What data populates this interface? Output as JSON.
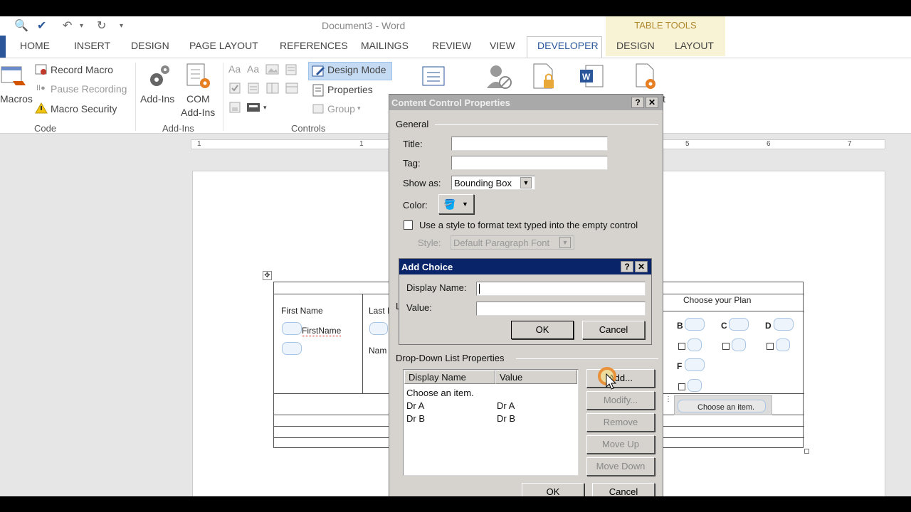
{
  "app": {
    "window_title": "Document3 - Word",
    "table_tools_label": "TABLE TOOLS"
  },
  "tabs": [
    "HOME",
    "INSERT",
    "DESIGN",
    "PAGE LAYOUT",
    "REFERENCES",
    "MAILINGS",
    "REVIEW",
    "VIEW",
    "DEVELOPER",
    "DESIGN",
    "LAYOUT"
  ],
  "ribbon": {
    "code": {
      "macros": "Macros",
      "record_macro": "Record Macro",
      "pause_recording": "Pause Recording",
      "macro_security": "Macro Security",
      "group_label": "Code"
    },
    "addins": {
      "add_ins": "Add-Ins",
      "com_line1": "COM",
      "com_line2": "Add-Ins",
      "group_label": "Add-Ins"
    },
    "controls": {
      "design_mode": "Design Mode",
      "properties": "Properties",
      "group": "Group",
      "group_label": "Controls"
    },
    "partial_t": "t"
  },
  "ruler": [
    "1",
    "1",
    "5",
    "6",
    "7"
  ],
  "document": {
    "first_name_label": "First Name",
    "first_name_field": "FirstName",
    "last_label": "Last I",
    "name_label": "Nam",
    "plan_header": "Choose your Plan",
    "plan_letters": [
      "B",
      "C",
      "D",
      "F"
    ],
    "choose_item": "Choose an item.",
    "pilcrow_l": "L"
  },
  "content_control_dialog": {
    "title": "Content Control Properties",
    "help_btn": "?",
    "close_btn": "✕",
    "general_label": "General",
    "title_label": "Title:",
    "tag_label": "Tag:",
    "show_as_label": "Show as:",
    "show_as_value": "Bounding Box",
    "color_label": "Color:",
    "use_style_label": "Use a style to format text typed into the empty control",
    "style_label": "Style:",
    "style_value": "Default Paragraph Font",
    "dropdown_section_label": "Drop-Down List Properties",
    "list_headers": [
      "Display Name",
      "Value"
    ],
    "list_rows": [
      {
        "display": "Choose an item.",
        "value": ""
      },
      {
        "display": "Dr A",
        "value": "Dr A"
      },
      {
        "display": "Dr B",
        "value": "Dr B"
      }
    ],
    "add_btn": "Add...",
    "modify_btn": "Modify...",
    "remove_btn": "Remove",
    "move_up_btn": "Move Up",
    "move_down_btn": "Move Down",
    "ok_btn": "OK",
    "cancel_btn": "Cancel"
  },
  "add_choice_dialog": {
    "title": "Add Choice",
    "help_btn": "?",
    "close_btn": "✕",
    "display_name_label": "Display Name:",
    "display_name_value": "",
    "value_label": "Value:",
    "value_value": "",
    "ok_btn": "OK",
    "cancel_btn": "Cancel"
  },
  "colors": {
    "word_blue": "#2b579a",
    "dialog_bg": "#d6d3ce",
    "active_title": "#0a246a",
    "table_tools_bg": "#f9f3d6"
  }
}
